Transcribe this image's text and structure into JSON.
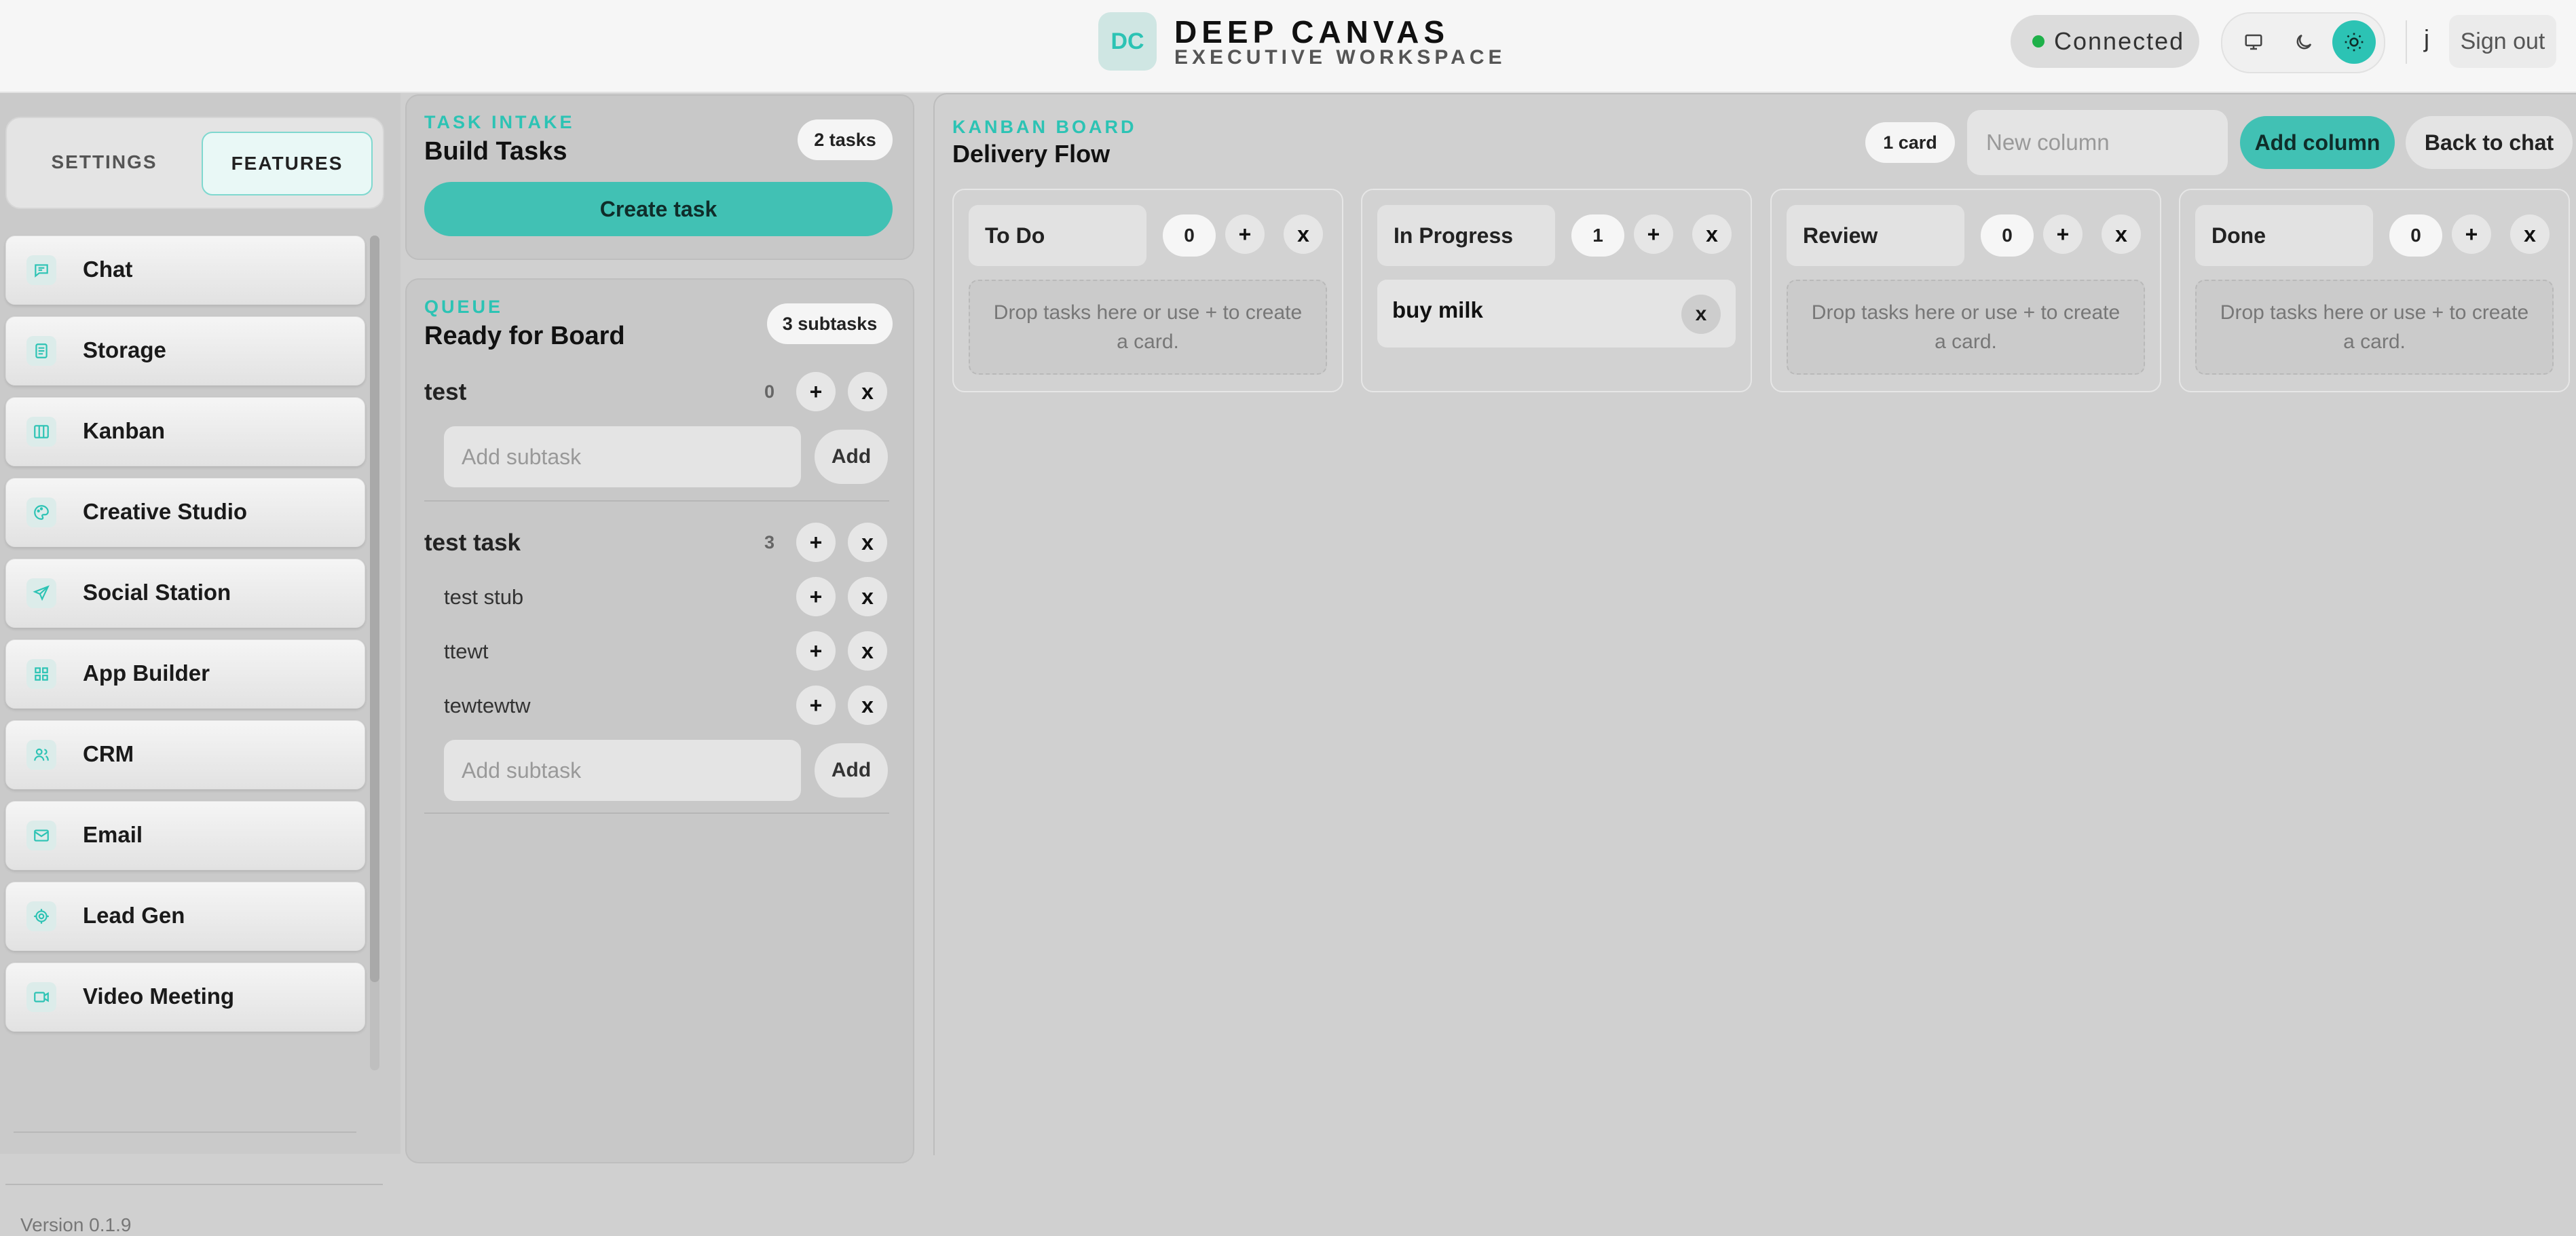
{
  "header": {
    "logo_initials": "DC",
    "brand_title": "DEEP CANVAS",
    "brand_subtitle": "EXECUTIVE WORKSPACE",
    "status": "Connected",
    "user_initial": "j",
    "sign_out": "Sign out",
    "theme_icons": [
      "monitor-icon",
      "moon-icon",
      "sun-icon"
    ],
    "active_theme": "light"
  },
  "sidebar": {
    "tabs": [
      "SETTINGS",
      "FEATURES"
    ],
    "active_tab": "FEATURES",
    "items": [
      {
        "label": "Chat",
        "icon": "chat-icon"
      },
      {
        "label": "Storage",
        "icon": "storage-icon"
      },
      {
        "label": "Kanban",
        "icon": "kanban-icon"
      },
      {
        "label": "Creative Studio",
        "icon": "palette-icon"
      },
      {
        "label": "Social Station",
        "icon": "send-icon"
      },
      {
        "label": "App Builder",
        "icon": "grid-icon"
      },
      {
        "label": "CRM",
        "icon": "users-icon"
      },
      {
        "label": "Email",
        "icon": "mail-icon"
      },
      {
        "label": "Lead Gen",
        "icon": "target-icon"
      },
      {
        "label": "Video Meeting",
        "icon": "video-icon"
      }
    ],
    "version": "Version 0.1.9"
  },
  "task_intake": {
    "eyebrow": "TASK INTAKE",
    "title": "Build Tasks",
    "count": "2 tasks",
    "create_label": "Create task"
  },
  "queue": {
    "eyebrow": "QUEUE",
    "title": "Ready for Board",
    "count": "3 subtasks",
    "subtask_placeholder": "Add subtask",
    "add_label": "Add",
    "tasks": [
      {
        "name": "test",
        "count": "0",
        "subtasks": []
      },
      {
        "name": "test task",
        "count": "3",
        "subtasks": [
          "test stub",
          "ttewt",
          "tewtewtw"
        ]
      }
    ]
  },
  "kanban": {
    "eyebrow": "KANBAN BOARD",
    "title": "Delivery Flow",
    "card_count": "1 card",
    "new_column_placeholder": "New column",
    "add_column": "Add column",
    "back": "Back to chat",
    "empty_hint": "Drop tasks here or use + to create a card.",
    "columns": [
      {
        "name": "To Do",
        "count": "0",
        "cards": []
      },
      {
        "name": "In Progress",
        "count": "1",
        "cards": [
          "buy milk"
        ]
      },
      {
        "name": "Review",
        "count": "0",
        "cards": []
      },
      {
        "name": "Done",
        "count": "0",
        "cards": []
      }
    ]
  },
  "colors": {
    "accent": "#2cc3b4",
    "accent_button": "#41c1b4",
    "status_ok": "#1fb14a"
  }
}
